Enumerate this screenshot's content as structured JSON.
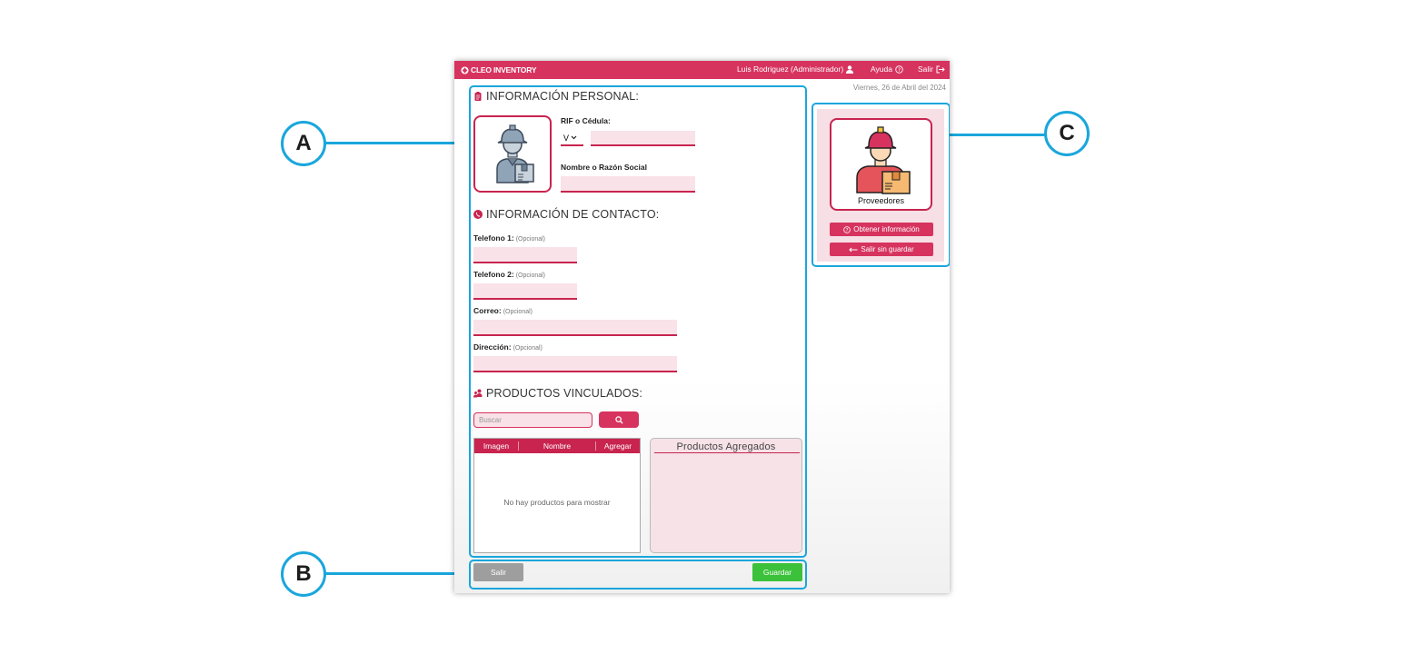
{
  "callouts": {
    "a": "A",
    "b": "B",
    "c": "C"
  },
  "header": {
    "brand": "CLEO INVENTORY",
    "user": "Luis Rodriguez (Administrador)",
    "help": "Ayuda",
    "logout": "Salir"
  },
  "date": "Viernes, 26 de Abril del 2024",
  "personal": {
    "title": "INFORMACIÓN PERSONAL:",
    "rif_label": "RIF o Cédula:",
    "rif_type": "V",
    "name_label": "Nombre o Razón Social"
  },
  "contact": {
    "title": "INFORMACIÓN DE CONTACTO:",
    "optional": "(Opcional)",
    "phone1_label": "Telefono 1:",
    "phone2_label": "Telefono 2:",
    "email_label": "Correo:",
    "address_label": "Dirección:"
  },
  "products": {
    "title": "PRODUCTOS VINCULADOS:",
    "search_placeholder": "Buscar",
    "columns": [
      "Imagen",
      "Nombre",
      "Agregar"
    ],
    "empty_message": "No hay productos para mostrar",
    "added_title": "Productos Agregados"
  },
  "footer": {
    "exit": "Salir",
    "save": "Guardar"
  },
  "side": {
    "card_label": "Proveedores",
    "info_button": "Obtener información",
    "exit_button": "Salir sin guardar"
  },
  "colors": {
    "primary": "#d7335f",
    "accent": "#1aa6dc",
    "field_bg": "#f9e2e8",
    "save": "#3cc13b",
    "exit": "#9e9e9e"
  }
}
